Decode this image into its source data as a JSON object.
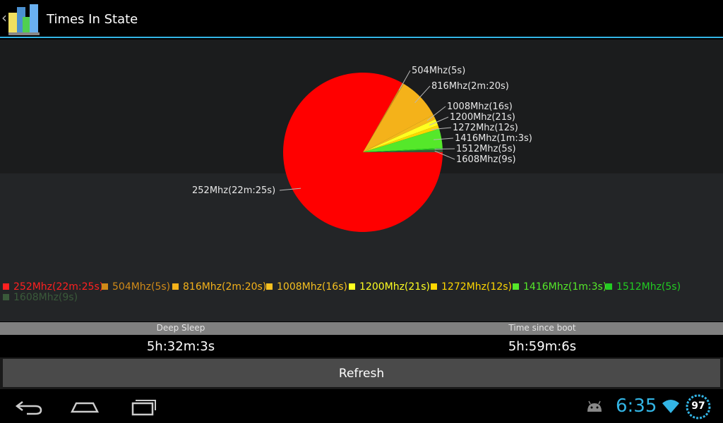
{
  "app": {
    "title": "Times In State"
  },
  "chart_data": {
    "type": "pie",
    "labels": [
      "252Mhz(22m:25s)",
      "504Mhz(5s)",
      "816Mhz(2m:20s)",
      "1008Mhz(16s)",
      "1200Mhz(21s)",
      "1272Mhz(12s)",
      "1416Mhz(1m:3s)",
      "1512Mhz(5s)",
      "1608Mhz(9s)"
    ],
    "values": [
      1345,
      5,
      140,
      16,
      21,
      12,
      63,
      5,
      9
    ],
    "colors": [
      "#ff0000",
      "#d08a18",
      "#f4b21a",
      "#f5b81a",
      "#ffff20",
      "#ffd700",
      "#55e82a",
      "#22cc22",
      "#3a5a3a"
    ],
    "legend_position": "bottom"
  },
  "legend": {
    "items": [
      {
        "label": "252Mhz(22m:25s)",
        "color": "#ff2020"
      },
      {
        "label": "504Mhz(5s)",
        "color": "#d08a18"
      },
      {
        "label": "816Mhz(2m:20s)",
        "color": "#f4b21a"
      },
      {
        "label": "1008Mhz(16s)",
        "color": "#f5c020"
      },
      {
        "label": "1200Mhz(21s)",
        "color": "#ffff20"
      },
      {
        "label": "1272Mhz(12s)",
        "color": "#ffd700"
      },
      {
        "label": "1416Mhz(1m:3s)",
        "color": "#55e82a"
      },
      {
        "label": "1512Mhz(5s)",
        "color": "#22cc22"
      },
      {
        "label": "1608Mhz(9s)",
        "color": "#3a5a3a"
      }
    ]
  },
  "stats": {
    "deep_sleep_label": "Deep Sleep",
    "deep_sleep_value": "5h:32m:3s",
    "boot_label": "Time since boot",
    "boot_value": "5h:59m:6s"
  },
  "actions": {
    "refresh_label": "Refresh"
  },
  "status": {
    "time": "6:35",
    "battery": "97",
    "accent": "#33b5e5"
  },
  "icons": {
    "back": "chevron-left-icon",
    "app": "chart-bars-icon",
    "nav_back": "back-icon",
    "nav_home": "home-icon",
    "nav_recents": "recents-icon",
    "android": "android-icon",
    "wifi": "wifi-icon",
    "battery": "battery-icon"
  }
}
